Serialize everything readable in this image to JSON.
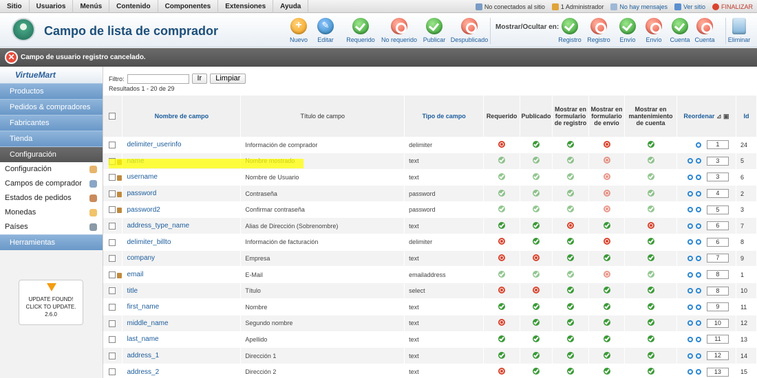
{
  "topmenu": [
    "Sitio",
    "Usuarios",
    "Menús",
    "Contenido",
    "Componentes",
    "Extensiones",
    "Ayuda"
  ],
  "status": {
    "not_connected": "No conectados al sitio",
    "admins": "1 Administrador",
    "messages": "No hay mensajes",
    "view_site": "Ver sitio",
    "logout": "FINALIZAR"
  },
  "header": {
    "title": "Campo de lista de comprador",
    "show_hide_label": "Mostrar/Ocultar en:",
    "buttons": [
      {
        "label": "Nuevo",
        "color": "orange"
      },
      {
        "label": "Editar",
        "color": "blue"
      },
      {
        "label": "Requerido",
        "color": "green"
      },
      {
        "label": "No requerido",
        "color": "red"
      },
      {
        "label": "Publicar",
        "color": "green"
      },
      {
        "label": "Despublicado",
        "color": "red"
      }
    ],
    "toggles": [
      {
        "label": "Registro",
        "color": "green"
      },
      {
        "label": "Registro",
        "color": "red"
      },
      {
        "label": "Envío",
        "color": "green"
      },
      {
        "label": "Envío",
        "color": "red"
      },
      {
        "label": "Cuenta",
        "color": "green"
      },
      {
        "label": "Cuenta",
        "color": "red"
      }
    ],
    "delete_label": "Eliminar"
  },
  "message": "Campo de usuario registro cancelado.",
  "sidebar": {
    "logo": "VirtueMart",
    "nav": [
      "Productos",
      "Pedidos & compradores",
      "Fabricantes",
      "Tienda",
      "Configuración"
    ],
    "active": "Configuración",
    "sub": [
      "Configuración",
      "Campos de comprador",
      "Estados de pedidos",
      "Monedas",
      "Países"
    ],
    "tools": "Herramientas",
    "update": {
      "line1": "UPDATE FOUND!",
      "line2": "CLICK TO UPDATE.",
      "version": "2.6.0"
    }
  },
  "filter": {
    "label": "Filtro:",
    "go": "Ir",
    "reset": "Limpiar",
    "value": ""
  },
  "results": "Resultados 1 - 20 de 29",
  "table": {
    "headers": {
      "name": "Nombre de campo",
      "title": "Título de campo",
      "type": "Tipo de campo",
      "required": "Requerido",
      "published": "Publicado",
      "registration": "Mostrar en formulario de registro",
      "shipping": "Mostrar en formulario de envío",
      "account": "Mostrar en mantenimiento de cuenta",
      "order": "Reordenar",
      "id": "Id"
    },
    "rows": [
      {
        "name": "delimiter_userinfo",
        "title": "Información de comprador",
        "type": "delimiter",
        "lock": false,
        "req": "no",
        "pub": "ok",
        "reg": "ok",
        "ship": "no",
        "acc": "ok",
        "faded": false,
        "up": false,
        "order": "1",
        "id": "24"
      },
      {
        "name": "name",
        "title": "Nombre mostrado",
        "type": "text",
        "lock": true,
        "req": "ok",
        "pub": "ok",
        "reg": "ok",
        "ship": "no",
        "acc": "ok",
        "faded": true,
        "up": true,
        "order": "3",
        "id": "5"
      },
      {
        "name": "username",
        "title": "Nombre de Usuario",
        "type": "text",
        "lock": true,
        "req": "ok",
        "pub": "ok",
        "reg": "ok",
        "ship": "no",
        "acc": "ok",
        "faded": true,
        "up": true,
        "order": "3",
        "id": "6"
      },
      {
        "name": "password",
        "title": "Contraseña",
        "type": "password",
        "lock": true,
        "req": "ok",
        "pub": "ok",
        "reg": "ok",
        "ship": "no",
        "acc": "ok",
        "faded": true,
        "up": true,
        "order": "4",
        "id": "2"
      },
      {
        "name": "password2",
        "title": "Confirmar contraseña",
        "type": "password",
        "lock": true,
        "req": "ok",
        "pub": "ok",
        "reg": "ok",
        "ship": "no",
        "acc": "ok",
        "faded": true,
        "up": true,
        "order": "5",
        "id": "3"
      },
      {
        "name": "address_type_name",
        "title": "Alias de Dirección (Sobrenombre)",
        "type": "text",
        "lock": false,
        "req": "ok",
        "pub": "ok",
        "reg": "no",
        "ship": "ok",
        "acc": "no",
        "faded": false,
        "up": true,
        "order": "6",
        "id": "7"
      },
      {
        "name": "delimiter_billto",
        "title": "Información de facturación",
        "type": "delimiter",
        "lock": false,
        "req": "no",
        "pub": "ok",
        "reg": "ok",
        "ship": "no",
        "acc": "ok",
        "faded": false,
        "up": true,
        "order": "6",
        "id": "8"
      },
      {
        "name": "company",
        "title": "Empresa",
        "type": "text",
        "lock": false,
        "req": "no",
        "pub": "no",
        "reg": "ok",
        "ship": "ok",
        "acc": "ok",
        "faded": false,
        "up": true,
        "order": "7",
        "id": "9"
      },
      {
        "name": "email",
        "title": "E-Mail",
        "type": "emailaddress",
        "lock": true,
        "req": "ok",
        "pub": "ok",
        "reg": "ok",
        "ship": "no",
        "acc": "ok",
        "faded": true,
        "up": true,
        "order": "8",
        "id": "1"
      },
      {
        "name": "title",
        "title": "Título",
        "type": "select",
        "lock": false,
        "req": "no",
        "pub": "no",
        "reg": "ok",
        "ship": "ok",
        "acc": "ok",
        "faded": false,
        "up": true,
        "order": "8",
        "id": "10"
      },
      {
        "name": "first_name",
        "title": "Nombre",
        "type": "text",
        "lock": false,
        "req": "ok",
        "pub": "ok",
        "reg": "ok",
        "ship": "ok",
        "acc": "ok",
        "faded": false,
        "up": true,
        "order": "9",
        "id": "11"
      },
      {
        "name": "middle_name",
        "title": "Segundo nombre",
        "type": "text",
        "lock": false,
        "req": "no",
        "pub": "ok",
        "reg": "ok",
        "ship": "ok",
        "acc": "ok",
        "faded": false,
        "up": true,
        "order": "10",
        "id": "12"
      },
      {
        "name": "last_name",
        "title": "Apellido",
        "type": "text",
        "lock": false,
        "req": "ok",
        "pub": "ok",
        "reg": "ok",
        "ship": "ok",
        "acc": "ok",
        "faded": false,
        "up": true,
        "order": "11",
        "id": "13"
      },
      {
        "name": "address_1",
        "title": "Dirección 1",
        "type": "text",
        "lock": false,
        "req": "ok",
        "pub": "ok",
        "reg": "ok",
        "ship": "ok",
        "acc": "ok",
        "faded": false,
        "up": true,
        "order": "12",
        "id": "14"
      },
      {
        "name": "address_2",
        "title": "Dirección 2",
        "type": "text",
        "lock": false,
        "req": "no",
        "pub": "ok",
        "reg": "ok",
        "ship": "ok",
        "acc": "ok",
        "faded": false,
        "up": true,
        "order": "13",
        "id": "15"
      }
    ]
  }
}
